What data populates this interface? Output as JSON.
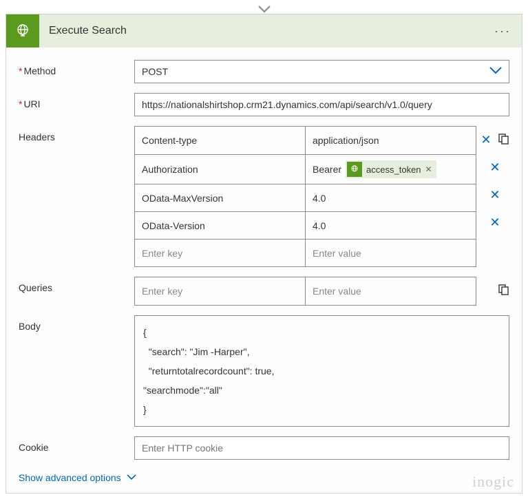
{
  "header": {
    "title": "Execute Search"
  },
  "labels": {
    "method": "Method",
    "uri": "URI",
    "headers": "Headers",
    "queries": "Queries",
    "body": "Body",
    "cookie": "Cookie",
    "advanced": "Show advanced options"
  },
  "method": {
    "value": "POST"
  },
  "uri": {
    "value": "https://nationalshirtshop.crm21.dynamics.com/api/search/v1.0/query"
  },
  "headers": {
    "rows": [
      {
        "key": "Content-type",
        "value": "application/json"
      },
      {
        "key": "Authorization",
        "valuePrefix": "Bearer",
        "token": "access_token"
      },
      {
        "key": "OData-MaxVersion",
        "value": "4.0"
      },
      {
        "key": "OData-Version",
        "value": "4.0"
      }
    ],
    "placeholderKey": "Enter key",
    "placeholderValue": "Enter value"
  },
  "queries": {
    "placeholderKey": "Enter key",
    "placeholderValue": "Enter value"
  },
  "bodyText": "{\n  \"search\": \"Jim -Harper\",\n  \"returntotalrecordcount\": true,\n\"searchmode\":\"all\"\n}",
  "cookie": {
    "placeholder": "Enter HTTP cookie"
  },
  "watermark": "inogic"
}
